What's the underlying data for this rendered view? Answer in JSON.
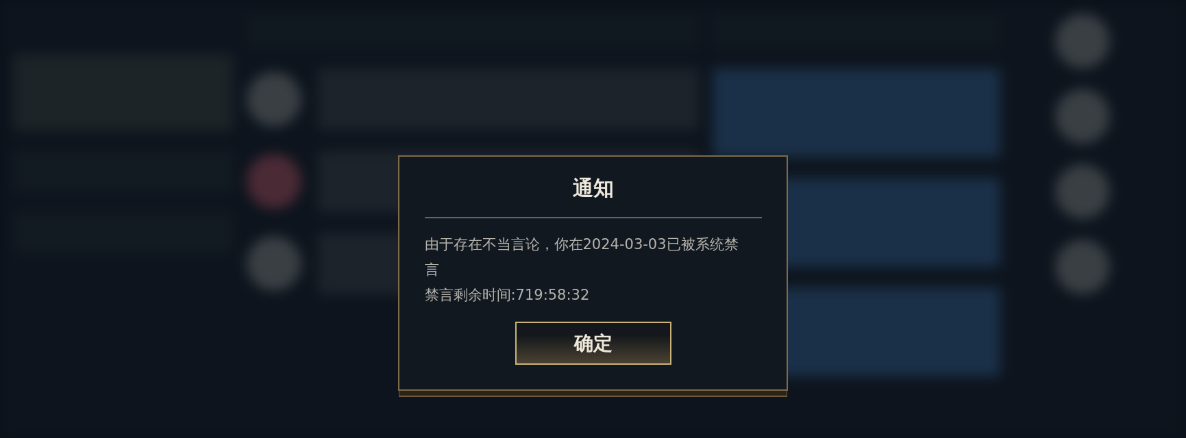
{
  "dialog": {
    "title": "通知",
    "message": "由于存在不当言论，你在2024-03-03已被系统禁言",
    "remaining": "禁言剩余时间:719:58:32",
    "buttons": [
      "确定"
    ]
  }
}
